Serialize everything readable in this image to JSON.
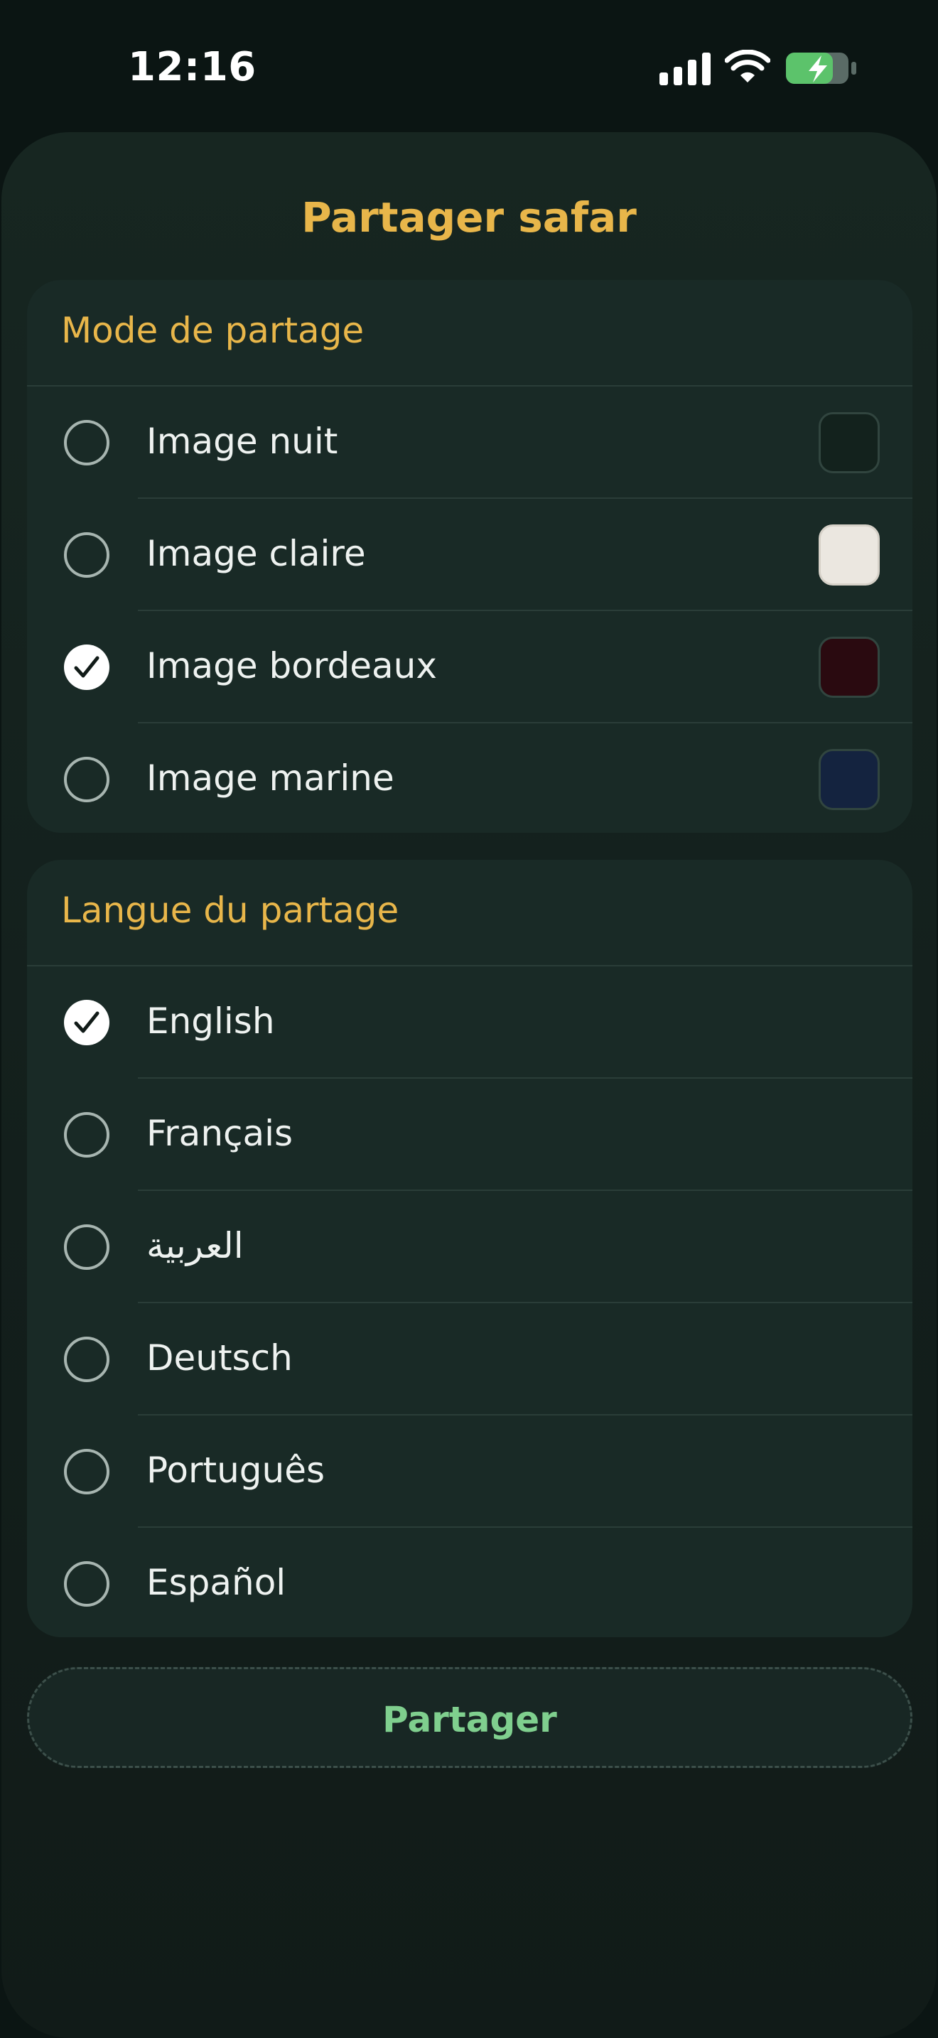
{
  "status_bar": {
    "time": "12:16",
    "battery_color": "#5cc36b"
  },
  "sheet": {
    "title": "Partager safar"
  },
  "share_mode": {
    "header": "Mode de partage",
    "options": [
      {
        "label": "Image nuit",
        "selected": false,
        "swatch_color": "#13221d"
      },
      {
        "label": "Image claire",
        "selected": false,
        "swatch_color": "#ebe7e0"
      },
      {
        "label": "Image bordeaux",
        "selected": true,
        "swatch_color": "#2a0a10"
      },
      {
        "label": "Image marine",
        "selected": false,
        "swatch_color": "#14233f"
      }
    ]
  },
  "share_language": {
    "header": "Langue du partage",
    "options": [
      {
        "label": "English",
        "selected": true
      },
      {
        "label": "Français",
        "selected": false
      },
      {
        "label": "العربية",
        "selected": false
      },
      {
        "label": "Deutsch",
        "selected": false
      },
      {
        "label": "Português",
        "selected": false
      },
      {
        "label": "Español",
        "selected": false
      }
    ]
  },
  "actions": {
    "share_label": "Partager"
  },
  "colors": {
    "accent": "#e8b64a",
    "action": "#7fcf8e",
    "background": "#0b1513",
    "card": "#192a26"
  }
}
